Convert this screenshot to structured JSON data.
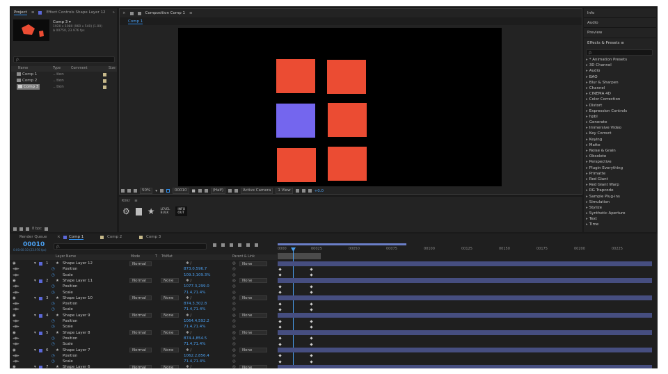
{
  "colors": {
    "accent": "#2d8ceb",
    "square_red": "#eb4c33",
    "square_purple": "#7466ee",
    "bar": "#464e80"
  },
  "project": {
    "tab_project": "Project",
    "tab_effect_controls": "Effect Controls Shape Layer 12",
    "comp_name": "Comp 3 ▾",
    "comp_info_1": "1920 x 1080 (960 x 540) (1.00)",
    "comp_info_2": "Δ 00750, 23.976 fps",
    "search_placeholder": "ρ.",
    "col_name": "Name",
    "col_type": "Type",
    "col_comment": "Comment",
    "col_size": "Size",
    "items": [
      {
        "name": "Comp 1",
        "type": "...tion"
      },
      {
        "name": "Comp 2",
        "type": "...tion"
      },
      {
        "name": "Comp 3",
        "type": "...tion"
      }
    ],
    "bpc": "8 bpc"
  },
  "composition": {
    "tab_title": "Composition Comp 1",
    "tab_label": "Comp 1",
    "zoom": "50%",
    "timecode": "00010",
    "resolution": "(Half)",
    "camera": "Active Camera",
    "view": "1 View",
    "exposure": "+0.0"
  },
  "klikr": {
    "title": "Klikr",
    "level": "LEVEL",
    "bulk": "BULK",
    "info_1": "INFO",
    "info_2": "OUT"
  },
  "right_panel": {
    "info": "Info",
    "audio": "Audio",
    "preview": "Preview",
    "effects_presets": "Effects & Presets",
    "search_placeholder": "ρ.",
    "categories": [
      "* Animation Presets",
      "3D Channel",
      "Audio",
      "BAO",
      "Blur & Sharpen",
      "Channel",
      "CINEMA 4D",
      "Color Correction",
      "Distort",
      "Expression Controls",
      "hpbl",
      "Generate",
      "Immersive Video",
      "Key Correct",
      "Keying",
      "Matte",
      "Noise & Grain",
      "Obsolete",
      "Perspective",
      "Plugin Everything",
      "Primatte",
      "Red Giant",
      "Red Giant Warp",
      "RG Trapcode",
      "Sample Plug-ins",
      "Simulation",
      "Stylize",
      "Synthetic Aperture",
      "Text",
      "Time"
    ]
  },
  "timeline": {
    "tab_render": "Render Queue",
    "tabs": [
      "Comp 1",
      "Comp 2",
      "Comp 3"
    ],
    "timecode": "00010",
    "timecode_sub": "0:00:00:10 (23.976 fps)",
    "search_placeholder": "ρ.",
    "col_layer_name": "Layer Name",
    "col_mode": "Mode",
    "col_t": "T",
    "col_trkmat": "TrkMat",
    "col_parent": "Parent & Link",
    "ticks": [
      "0000",
      "00025",
      "00050",
      "00075",
      "00100",
      "00125",
      "00150",
      "00175",
      "00200",
      "00225"
    ],
    "layers": [
      {
        "num": "1",
        "name": "Shape Layer 12",
        "mode": "Normal",
        "trkmat": "",
        "parent": "None",
        "position": "873.0,596.7",
        "scale": "109.3,109.3%"
      },
      {
        "num": "2",
        "name": "Shape Layer 11",
        "mode": "Normal",
        "trkmat": "None",
        "parent": "None",
        "position": "1077.3,299.0",
        "scale": "71.4,71.4%"
      },
      {
        "num": "3",
        "name": "Shape Layer 10",
        "mode": "Normal",
        "trkmat": "None",
        "parent": "None",
        "position": "874.3,302.8",
        "scale": "71.4,71.4%"
      },
      {
        "num": "4",
        "name": "Shape Layer 9",
        "mode": "Normal",
        "trkmat": "None",
        "parent": "None",
        "position": "1064.4,592.2",
        "scale": "71.4,71.4%"
      },
      {
        "num": "5",
        "name": "Shape Layer 8",
        "mode": "Normal",
        "trkmat": "None",
        "parent": "None",
        "position": "874.4,854.5",
        "scale": "71.4,71.4%"
      },
      {
        "num": "6",
        "name": "Shape Layer 7",
        "mode": "Normal",
        "trkmat": "None",
        "parent": "None",
        "position": "1062.2,856.4",
        "scale": "71.4,71.4%"
      },
      {
        "num": "7",
        "name": "Shape Layer 6",
        "mode": "Normal",
        "trkmat": "None",
        "parent": "None",
        "position": "",
        "scale": ""
      }
    ],
    "prop_position": "Position",
    "prop_scale": "Scale"
  }
}
